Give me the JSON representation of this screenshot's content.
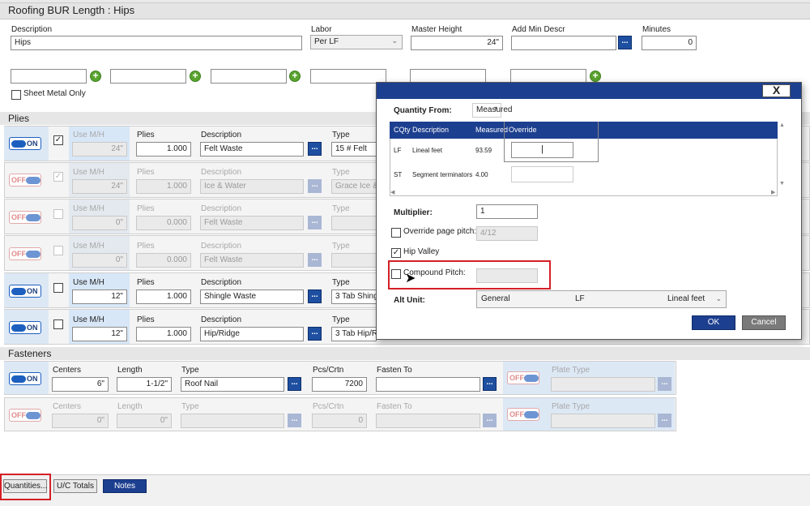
{
  "window": {
    "title": "Roofing BUR Length : Hips"
  },
  "header": {
    "description_label": "Description",
    "description_value": "Hips",
    "labor_label": "Labor",
    "labor_value": "Per LF",
    "master_height_label": "Master Height",
    "master_height_value": "24\"",
    "add_min_label": "Add Min Descr",
    "add_min_value": "",
    "minutes_label": "Minutes",
    "minutes_value": "0",
    "sheet_metal_label": "Sheet Metal Only"
  },
  "plies": {
    "section_label": "Plies",
    "rows": [
      {
        "toggle": "ON",
        "checked": true,
        "use_label": "Use M/H",
        "use_value": "24\"",
        "plies_label": "Plies",
        "plies_value": "1.000",
        "desc_label": "Description",
        "desc_value": "Felt Waste",
        "type_label": "Type",
        "type_value": "15 # Felt"
      },
      {
        "toggle": "OFF",
        "checked": true,
        "use_label": "Use M/H",
        "use_value": "24\"",
        "plies_label": "Plies",
        "plies_value": "1.000",
        "desc_label": "Description",
        "desc_value": "Ice & Water",
        "type_label": "Type",
        "type_value": "Grace Ice &"
      },
      {
        "toggle": "OFF",
        "checked": false,
        "use_label": "Use M/H",
        "use_value": "0\"",
        "plies_label": "Plies",
        "plies_value": "0.000",
        "desc_label": "Description",
        "desc_value": "Felt Waste",
        "type_label": "Type",
        "type_value": ""
      },
      {
        "toggle": "OFF",
        "checked": false,
        "use_label": "Use M/H",
        "use_value": "0\"",
        "plies_label": "Plies",
        "plies_value": "0.000",
        "desc_label": "Description",
        "desc_value": "Felt Waste",
        "type_label": "Type",
        "type_value": ""
      },
      {
        "toggle": "ON",
        "checked": false,
        "use_label": "Use M/H",
        "use_value": "12\"",
        "plies_label": "Plies",
        "plies_value": "1.000",
        "desc_label": "Description",
        "desc_value": "Shingle Waste",
        "type_label": "Type",
        "type_value": "3 Tab Shingle"
      },
      {
        "toggle": "ON",
        "checked": false,
        "use_label": "Use M/H",
        "use_value": "12\"",
        "plies_label": "Plies",
        "plies_value": "1.000",
        "desc_label": "Description",
        "desc_value": "Hip/Ridge",
        "type_label": "Type",
        "type_value": "3 Tab Hip/Rid"
      }
    ]
  },
  "fasteners": {
    "section_label": "Fasteners",
    "rows": [
      {
        "toggle": "ON",
        "centers_label": "Centers",
        "centers_value": "6\"",
        "length_label": "Length",
        "length_value": "1-1/2\"",
        "type_label": "Type",
        "type_value": "Roof Nail",
        "pcs_label": "Pcs/Crtn",
        "pcs_value": "7200",
        "fasten_label": "Fasten To",
        "fasten_value": "",
        "plate_toggle": "OFF",
        "plate_label": "Plate Type"
      },
      {
        "toggle": "OFF",
        "centers_label": "Centers",
        "centers_value": "0\"",
        "length_label": "Length",
        "length_value": "0\"",
        "type_label": "Type",
        "type_value": "",
        "pcs_label": "Pcs/Crtn",
        "pcs_value": "0",
        "fasten_label": "Fasten To",
        "fasten_value": "",
        "plate_toggle": "OFF",
        "plate_label": "Plate Type"
      }
    ]
  },
  "dialog": {
    "close": "X",
    "quantity_from_label": "Quantity From:",
    "quantity_from_value": "Measured",
    "grid_headers": [
      "CQty",
      "Description",
      "Measured",
      "Override"
    ],
    "grid_rows": [
      {
        "cqty": "LF",
        "description": "Lineal feet",
        "measured": "93.59",
        "override": "|"
      },
      {
        "cqty": "ST",
        "description": "Segment terminators",
        "measured": "4.00",
        "override": ""
      }
    ],
    "multiplier_label": "Multiplier:",
    "multiplier_value": "1",
    "override_pitch_label": "Override page pitch:",
    "override_pitch_value": "4/12",
    "hip_valley_label": "Hip Valley",
    "compound_pitch_label": "Compound Pitch:",
    "compound_pitch_value": "",
    "alt_unit_label": "Alt Unit:",
    "alt_unit_values": [
      "General",
      "LF",
      "Lineal feet"
    ],
    "ok": "OK",
    "cancel": "Cancel"
  },
  "bottom": {
    "quantities": "Quantities...",
    "uc_totals": "U/C Totals",
    "notes": "Notes"
  },
  "colors": {
    "accent": "#1d3f8f",
    "highlight": "#d41f26",
    "add": "#5aa42f"
  }
}
